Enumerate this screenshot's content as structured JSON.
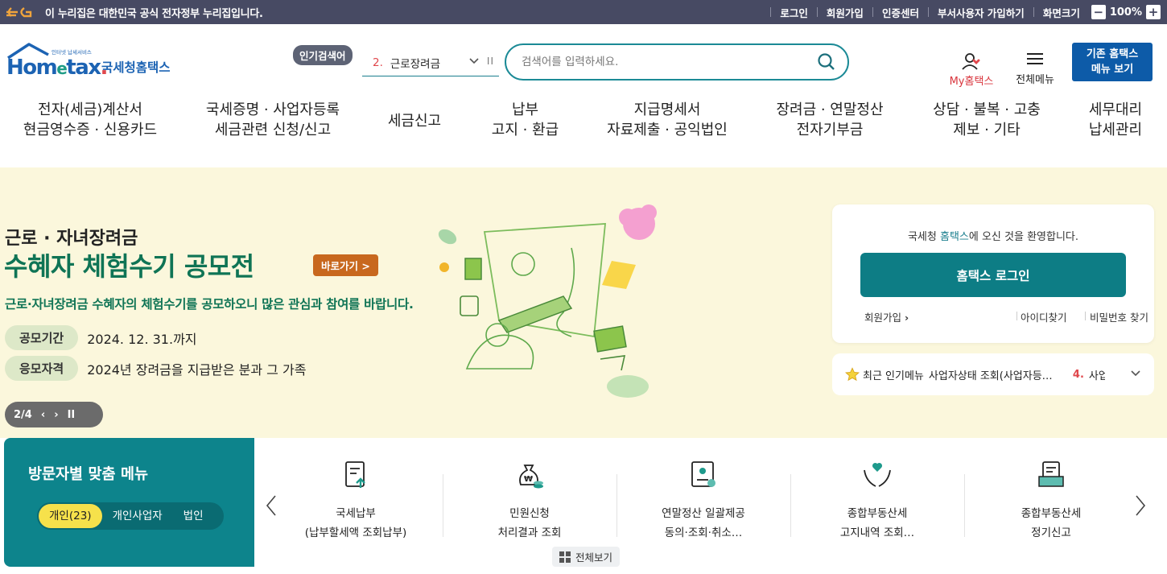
{
  "govbar": {
    "notice": "이 누리집은 대한민국 공식 전자정부 누리집입니다.",
    "links": [
      "로그인",
      "회원가입",
      "인증센터",
      "부서사용자 가입하기",
      "화면크기"
    ],
    "zoom": "100%",
    "zoom_minus": "−",
    "zoom_plus": "+"
  },
  "header": {
    "logo_small": "인터넷 납세서비스",
    "logo_main": "Hometax",
    "logo_kr": "국세청홈택스",
    "popular_label": "인기검색어",
    "popular_rank": "2.",
    "popular_keyword": "근로장려금",
    "search_placeholder": "검색어를 입력하세요.",
    "my_label": "My홈택스",
    "allmenu_label": "전체메뉴",
    "legacy_line1": "기존 홈택스",
    "legacy_line2": "메뉴 보기"
  },
  "gnb": [
    {
      "l1": "전자(세금)계산서",
      "l2": "현금영수증 · 신용카드"
    },
    {
      "l1": "국세증명 · 사업자등록",
      "l2": "세금관련 신청/신고"
    },
    {
      "l1": "세금신고",
      "l2": ""
    },
    {
      "l1": "납부",
      "l2": "고지 · 환급"
    },
    {
      "l1": "지급명세서",
      "l2": "자료제출 · 공익법인"
    },
    {
      "l1": "장려금 · 연말정산",
      "l2": "전자기부금"
    },
    {
      "l1": "상담 · 불복 · 고충",
      "l2": "제보 · 기타"
    },
    {
      "l1": "세무대리",
      "l2": "납세관리"
    }
  ],
  "hero": {
    "subtitle": "근로 · 자녀장려금",
    "title": "수혜자 체험수기 공모전",
    "button": "바로가기 >",
    "desc": "근로·자녀장려금 수혜자의 체험수기를 공모하오니 많은 관심과 참여를 바랍니다.",
    "rows": [
      {
        "tag": "공모기간",
        "value": "2024. 12. 31.까지"
      },
      {
        "tag": "응모자격",
        "value": "2024년 장려금을 지급받은 분과 그 가족"
      }
    ],
    "pager": "2/4"
  },
  "login": {
    "welcome_pre": "국세청 ",
    "welcome_hl": "홈택스",
    "welcome_post": "에 오신 것을 환영합니다.",
    "button": "홈택스 로그인",
    "join": "회원가입",
    "find_id": "아이디찾기",
    "find_pw": "비밀번호 찾기"
  },
  "recent": {
    "label": "최근 인기메뉴",
    "item1": "사업자상태 조회(사업자등록상태)",
    "rank": "4.",
    "item2": "사업"
  },
  "visitor": {
    "title": "방문자별 맞춤 메뉴",
    "tabs": [
      "개인(23)",
      "개인사업자",
      "법인"
    ]
  },
  "quick": {
    "items": [
      {
        "l1": "국세납부",
        "l2": "(납부할세액 조회납부)",
        "icon": "document-upload-icon"
      },
      {
        "l1": "민원신청",
        "l2": "처리결과 조회",
        "icon": "money-bag-icon"
      },
      {
        "l1": "연말정산 일괄제공",
        "l2": "동의·조회·취소…",
        "icon": "certificate-icon"
      },
      {
        "l1": "종합부동산세",
        "l2": "고지내역 조회…",
        "icon": "heart-hands-icon"
      },
      {
        "l1": "종합부동산세",
        "l2": "정기신고",
        "icon": "file-tray-icon"
      }
    ],
    "view_all": "전체보기"
  },
  "colors": {
    "govbar": "#474a63",
    "teal": "#0d848c",
    "hero_bg": "#fbf7dc",
    "hero_green": "#0f7455",
    "legacy_blue": "#0d5ba8",
    "tab_yellow": "#f6e14b"
  }
}
